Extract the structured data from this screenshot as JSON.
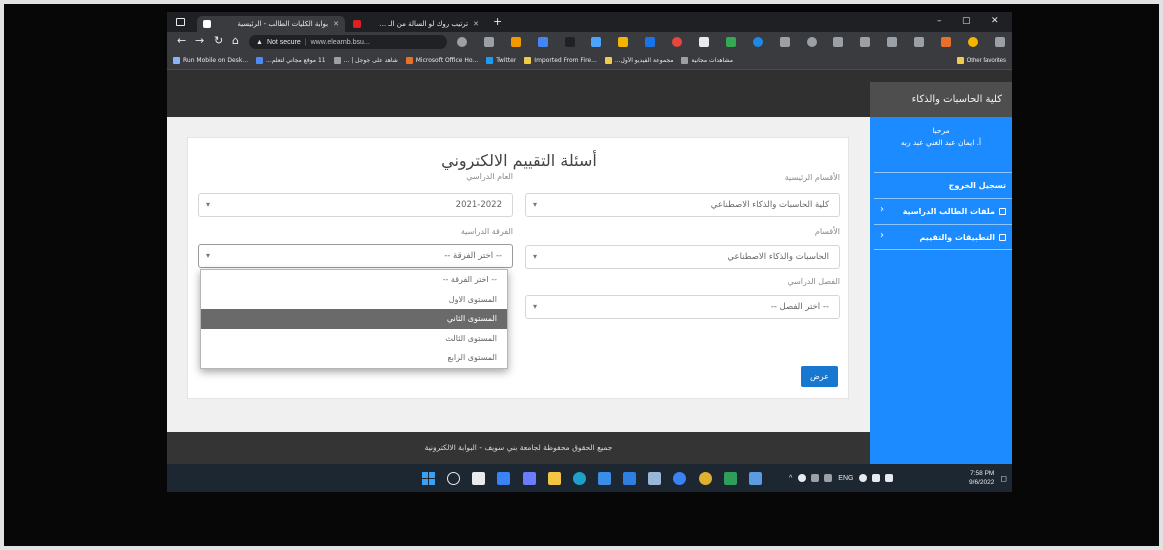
{
  "browser": {
    "tabs": [
      {
        "title": "بوابة الكليات الطالب - الرئيسية",
        "favicon_color": "#ffffff",
        "close": "✕"
      },
      {
        "title": "ترتيب روك لو السالة من الـ ...",
        "favicon_color": "#e02020",
        "close": "✕"
      }
    ],
    "new_tab": "+",
    "window_controls": {
      "minimize": "–",
      "maximize": "▢",
      "close": "✕"
    },
    "nav": {
      "back": "←",
      "forward": "→",
      "refresh": "↻",
      "home": "⌂"
    },
    "address": {
      "warning": "▲",
      "security": "Not secure",
      "separator": "|",
      "url": "www.elearnb.bsu..."
    },
    "extension_icons": [
      {
        "name": "zoom-icon",
        "color": "#9aa0a6",
        "shape": "circle"
      },
      {
        "name": "share-icon",
        "color": "#9aa0a6",
        "shape": "square"
      },
      {
        "name": "browser-extension-icon",
        "color": "#f29900",
        "shape": "square"
      },
      {
        "name": "browser-extension-icon",
        "color": "#4285f4",
        "shape": "square"
      },
      {
        "name": "browser-extension-icon",
        "color": "#202124",
        "shape": "square"
      },
      {
        "name": "browser-extension-icon",
        "color": "#4aa3ff",
        "shape": "square"
      },
      {
        "name": "browser-extension-icon",
        "color": "#f4b400",
        "shape": "square"
      },
      {
        "name": "browser-extension-icon",
        "color": "#1a73e8",
        "shape": "square"
      },
      {
        "name": "browser-extension-icon",
        "color": "#e8453c",
        "shape": "circle"
      },
      {
        "name": "browser-extension-icon",
        "color": "#e8eaed",
        "shape": "square"
      },
      {
        "name": "browser-extension-icon",
        "color": "#34a853",
        "shape": "square"
      },
      {
        "name": "browser-extension-icon",
        "color": "#1e88e5",
        "shape": "circle"
      },
      {
        "name": "browser-extension-icon",
        "color": "#9aa0a6",
        "shape": "square"
      },
      {
        "name": "favorites-icon",
        "color": "#9aa0a6",
        "shape": "circle"
      },
      {
        "name": "collections-icon",
        "color": "#9aa0a6",
        "shape": "square"
      },
      {
        "name": "browser-extension-icon",
        "color": "#9aa0a6",
        "shape": "square"
      },
      {
        "name": "browser-extension-icon",
        "color": "#9aa0a6",
        "shape": "square"
      },
      {
        "name": "browser-extension-icon",
        "color": "#9aa0a6",
        "shape": "square"
      },
      {
        "name": "browser-extension-icon",
        "color": "#e8702a",
        "shape": "square"
      },
      {
        "name": "profile-icon",
        "color": "#f4b400",
        "shape": "circle"
      },
      {
        "name": "more-options-icon",
        "color": "#9aa0a6",
        "shape": "square"
      }
    ],
    "bookmarks": [
      {
        "label": "Run Mobile on Desk...",
        "icon_color": "#8ab4f8"
      },
      {
        "label": "11 موقع مجاني لتعلم...",
        "icon_color": "#4c8bf5"
      },
      {
        "label": "شاهد على جوجل | ...",
        "icon_color": "#9aa0a6"
      },
      {
        "label": "Microsoft Office Ho...",
        "icon_color": "#e8702a"
      },
      {
        "label": "Twitter",
        "icon_color": "#1d9bf0"
      },
      {
        "label": "Imported From Fire...",
        "icon_color": "#f2c94c"
      },
      {
        "label": "مجموعة الفيديو الأول...",
        "icon_color": "#f2c94c"
      },
      {
        "label": "مشاهدات مجانية",
        "icon_color": "#9aa0a6"
      }
    ],
    "other_favorites": {
      "label": "Other favorites",
      "icon_color": "#f2c94c"
    }
  },
  "site": {
    "brand": "كلية الحاسبات والذكاء",
    "sidebar": {
      "welcome": "مرحبا",
      "user_line": "أ. ايمان عبد الغني عبد ربه",
      "items": [
        {
          "label": "تسجيل الخروج"
        },
        {
          "label": "ملفات الطالب الدراسية",
          "chevron": "‹"
        },
        {
          "label": "التطبيقات والتقييم",
          "chevron": "‹"
        }
      ]
    },
    "form": {
      "title": "أسئلة التقييم الالكتروني",
      "main_department": {
        "label": "الأقسام الرئيسية",
        "value": "كلية الحاسبات والذكاء الاصطناعي"
      },
      "department": {
        "label": "الأقسام",
        "value": "الحاسبات والذكاء الاصطناعي"
      },
      "semester": {
        "label": "الفصل الدراسي",
        "value": "-- اختر الفصل --"
      },
      "academic_year": {
        "label": "العام الدراسي",
        "value": "2021-2022"
      },
      "grade": {
        "label": "الفرقة الدراسية",
        "value": "-- اختر الفرقة --",
        "options": [
          "-- اختر الفرقة --",
          "المستوى الاول",
          "المستوى الثاني",
          "المستوى الثالث",
          "المستوى الرابع"
        ],
        "highlighted_index": 2
      },
      "caret": "▾",
      "submit_label": "عرض"
    },
    "footer": "جميع الحقوق محفوظة لجامعة بني سويف - البوابة الالكترونية"
  },
  "taskbar": {
    "apps": [
      {
        "name": "windows-start-icon",
        "color": "#3aa0f3",
        "shape": "grid"
      },
      {
        "name": "search-icon",
        "color": "#e8eaed",
        "shape": "ring"
      },
      {
        "name": "task-view-icon",
        "color": "#e8eaed",
        "shape": "square"
      },
      {
        "name": "widgets-icon",
        "color": "#3b82f6",
        "shape": "square"
      },
      {
        "name": "chat-icon",
        "color": "#6b7cff",
        "shape": "square"
      },
      {
        "name": "file-explorer-icon",
        "color": "#f4c542",
        "shape": "square"
      },
      {
        "name": "edge-icon",
        "color": "#1fa0c8",
        "shape": "circle"
      },
      {
        "name": "store-icon",
        "color": "#3a8ee6",
        "shape": "square"
      },
      {
        "name": "mail-icon",
        "color": "#2f7fe0",
        "shape": "square"
      },
      {
        "name": "app-icon",
        "color": "#9ab7d8",
        "shape": "square"
      },
      {
        "name": "app-icon",
        "color": "#3b82f6",
        "shape": "circle"
      },
      {
        "name": "chrome-icon",
        "color": "#e0b030",
        "shape": "circle"
      },
      {
        "name": "app-icon",
        "color": "#2e9e5b",
        "shape": "square"
      },
      {
        "name": "app-icon",
        "color": "#5b9be0",
        "shape": "square"
      }
    ],
    "tray_chevron": "^",
    "tray_icons": [
      {
        "name": "onedrive-icon",
        "color": "#e8eaed",
        "shape": "circle"
      },
      {
        "name": "tray-app-icon",
        "color": "#9aa0a6",
        "shape": "square"
      },
      {
        "name": "tray-app-icon",
        "color": "#9aa0a6",
        "shape": "square"
      }
    ],
    "language": "ENG",
    "status_icons": [
      {
        "name": "wifi-icon",
        "color": "#e8eaed",
        "shape": "circle"
      },
      {
        "name": "volume-icon",
        "color": "#e8eaed",
        "shape": "square"
      },
      {
        "name": "battery-icon",
        "color": "#e8eaed",
        "shape": "square"
      }
    ],
    "time": "7:58 PM",
    "date": "9/6/2022",
    "notification": "◻"
  }
}
